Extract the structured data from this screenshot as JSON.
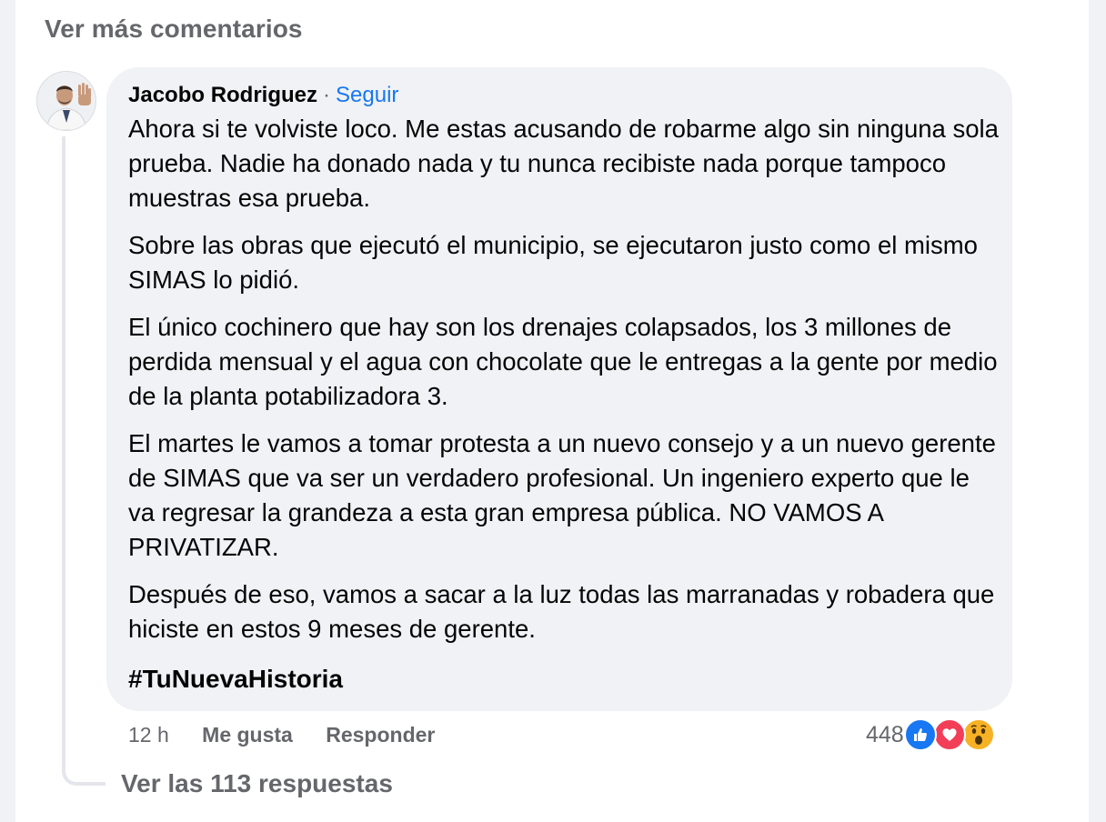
{
  "more_comments_label": "Ver más comentarios",
  "comment": {
    "author": "Jacobo Rodriguez",
    "separator": "·",
    "follow_label": "Seguir",
    "paragraphs": [
      "Ahora si te volviste loco. Me estas acusando de robarme algo sin ninguna sola prueba. Nadie ha donado nada y tu nunca recibiste nada porque tampoco muestras esa prueba.",
      "Sobre las obras que ejecutó el municipio, se ejecutaron justo como el mismo SIMAS lo pidió.",
      "El único cochinero que hay son los drenajes colapsados, los 3 millones de perdida mensual y el agua con chocolate que le entregas a la gente por medio de la planta potabilizadora 3.",
      "El martes le vamos a tomar protesta a un nuevo consejo y a un nuevo gerente de SIMAS que va ser un verdadero profesional. Un ingeniero experto que le va regresar la grandeza a esta gran empresa pública. NO VAMOS A PRIVATIZAR.",
      "Después de eso, vamos a sacar a la luz todas las marranadas y robadera que hiciste en estos 9 meses de gerente."
    ],
    "hashtag": "#TuNuevaHistoria",
    "timestamp": "12 h",
    "like_label": "Me gusta",
    "reply_label": "Responder",
    "reaction_count": "448",
    "reactions": [
      "like-icon",
      "love-icon",
      "wow-icon"
    ]
  },
  "view_replies_label": "Ver las 113 respuestas",
  "colors": {
    "background": "#f0f2f5",
    "link": "#1877f2",
    "muted_text": "#65676b",
    "like": "#1877f2",
    "love": "#f33e58",
    "wow": "#f7b125"
  }
}
